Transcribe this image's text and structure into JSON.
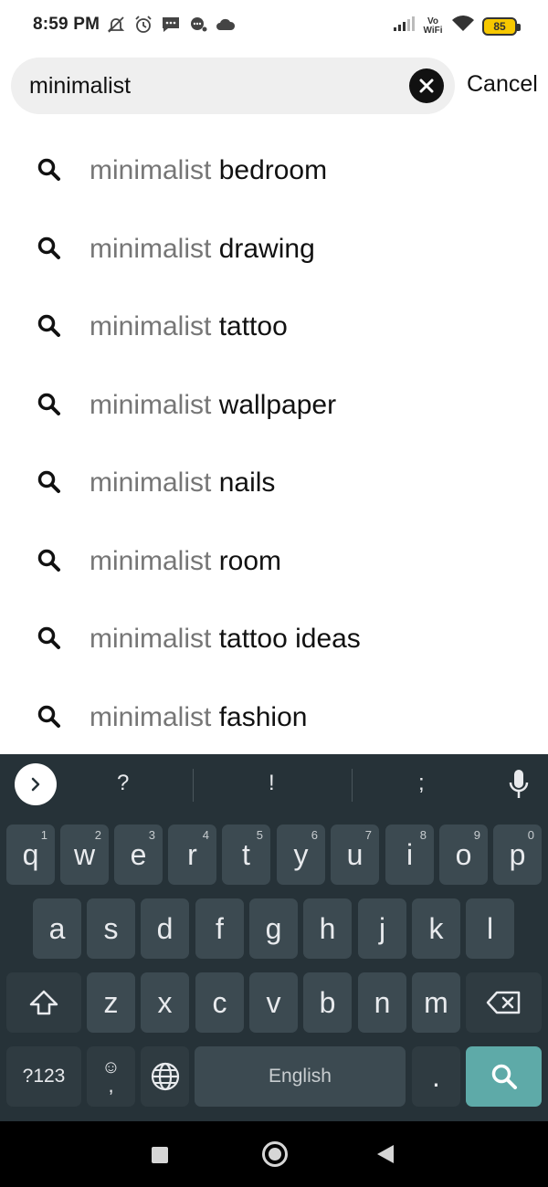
{
  "status_bar": {
    "time": "8:59 PM",
    "left_icons": [
      "notifications-muted-icon",
      "alarm-icon",
      "message-icon",
      "chat-icon",
      "cloud-icon"
    ],
    "right_icons": [
      "signal-icon",
      "vowifi-icon",
      "wifi-icon",
      "battery-icon"
    ],
    "vowifi_top": "Vo",
    "vowifi_bottom": "WiFi",
    "battery": "85"
  },
  "search": {
    "value": "minimalist",
    "placeholder": "",
    "cancel_label": "Cancel"
  },
  "suggestions": [
    {
      "prefix": "minimalist",
      "suffix": " bedroom"
    },
    {
      "prefix": "minimalist",
      "suffix": " drawing"
    },
    {
      "prefix": "minimalist",
      "suffix": " tattoo"
    },
    {
      "prefix": "minimalist",
      "suffix": " wallpaper"
    },
    {
      "prefix": "minimalist",
      "suffix": " nails"
    },
    {
      "prefix": "minimalist",
      "suffix": " room"
    },
    {
      "prefix": "minimalist",
      "suffix": " tattoo ideas"
    },
    {
      "prefix": "minimalist",
      "suffix": " fashion"
    }
  ],
  "keyboard": {
    "suggestion_strip": [
      "?",
      "!",
      ";"
    ],
    "row1": [
      {
        "key": "q",
        "hint": "1"
      },
      {
        "key": "w",
        "hint": "2"
      },
      {
        "key": "e",
        "hint": "3"
      },
      {
        "key": "r",
        "hint": "4"
      },
      {
        "key": "t",
        "hint": "5"
      },
      {
        "key": "y",
        "hint": "6"
      },
      {
        "key": "u",
        "hint": "7"
      },
      {
        "key": "i",
        "hint": "8"
      },
      {
        "key": "o",
        "hint": "9"
      },
      {
        "key": "p",
        "hint": "0"
      }
    ],
    "row2": [
      "a",
      "s",
      "d",
      "f",
      "g",
      "h",
      "j",
      "k",
      "l"
    ],
    "row3": [
      "z",
      "x",
      "c",
      "v",
      "b",
      "n",
      "m"
    ],
    "symbols_label": "?123",
    "emoji_top": "☺",
    "emoji_bottom": ",",
    "space_label": "English",
    "period_label": ".",
    "colors": {
      "background": "#263238",
      "key": "#3c4a51",
      "accent": "#5eaaa8"
    }
  }
}
